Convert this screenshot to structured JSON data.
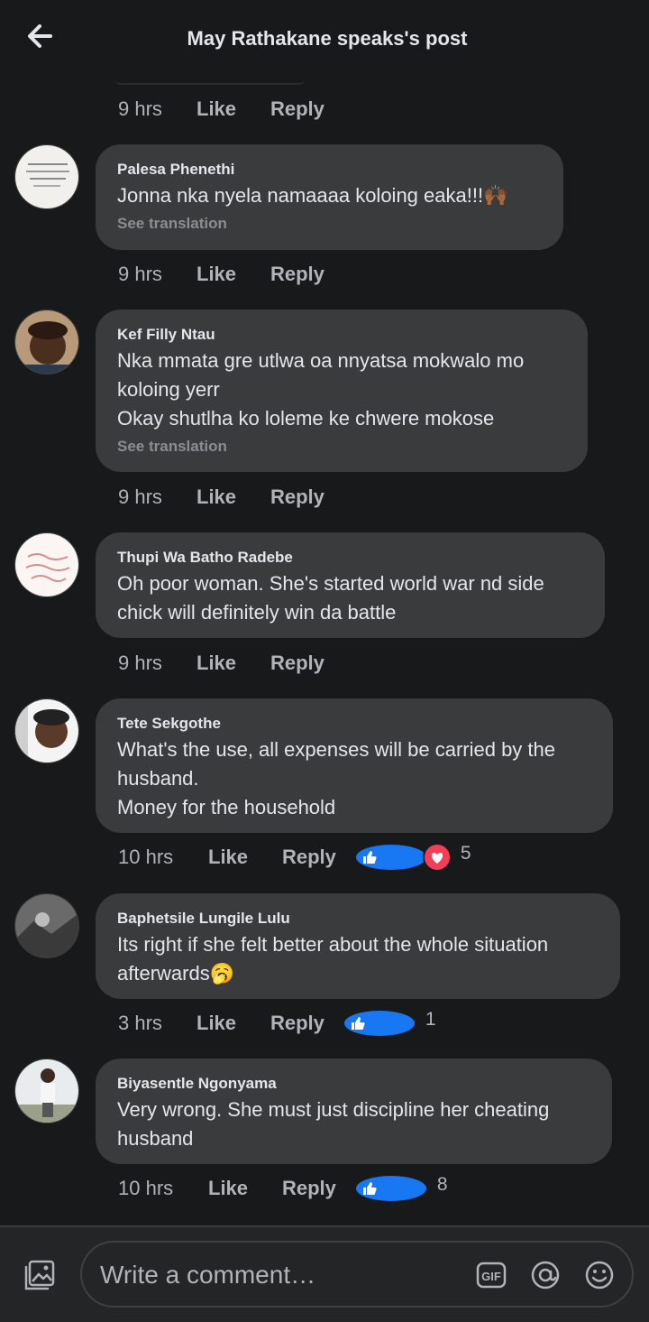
{
  "header": {
    "title": "May Rathakane speaks's post"
  },
  "top_meta": {
    "time": "9 hrs",
    "like": "Like",
    "reply": "Reply"
  },
  "comments": [
    {
      "author": "Palesa Phenethi",
      "text": "Jonna nka nyela namaaaa koloing eaka!!!🙌🏾",
      "translation": "See translation",
      "time": "9 hrs",
      "like": "Like",
      "reply": "Reply"
    },
    {
      "author": "Kef Filly Ntau",
      "text": "Nka mmata gre utlwa oa nnyatsa mokwalo mo koloing yerr\nOkay shutlha ko loleme ke chwere mokose",
      "translation": "See translation",
      "time": "9 hrs",
      "like": "Like",
      "reply": "Reply"
    },
    {
      "author": "Thupi Wa Batho Radebe",
      "text": "Oh poor woman. She's started world war nd side chick will definitely win da battle",
      "time": "9 hrs",
      "like": "Like",
      "reply": "Reply"
    },
    {
      "author": "Tete Sekgothe",
      "text": "What's the use, all expenses will be carried by the husband.\nMoney for the household",
      "time": "10 hrs",
      "like": "Like",
      "reply": "Reply",
      "reactions": [
        "like",
        "love"
      ],
      "reaction_count": "5"
    },
    {
      "author": "Baphetsile Lungile Lulu",
      "text": "Its right if she felt better about the whole situation afterwards🥱",
      "time": "3 hrs",
      "like": "Like",
      "reply": "Reply",
      "reactions": [
        "like"
      ],
      "reaction_count": "1"
    },
    {
      "author": "Biyasentle Ngonyama",
      "text": "Very wrong. She must just discipline her cheating husband",
      "time": "10 hrs",
      "like": "Like",
      "reply": "Reply",
      "reactions": [
        "like"
      ],
      "reaction_count": "8"
    }
  ],
  "composer": {
    "placeholder": "Write a comment…"
  },
  "colors": {
    "background": "#18191a",
    "bubble": "#3a3b3c",
    "like_blue": "#1877f2",
    "love_red": "#f33e58"
  }
}
